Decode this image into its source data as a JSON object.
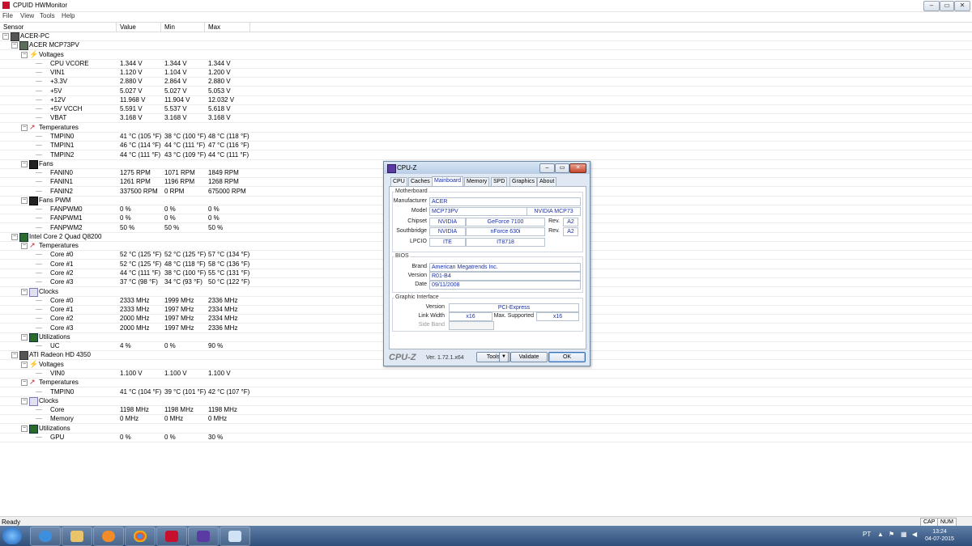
{
  "window": {
    "title": "CPUID HWMonitor",
    "menu": [
      "File",
      "View",
      "Tools",
      "Help"
    ]
  },
  "columns": {
    "sensor": "Sensor",
    "value": "Value",
    "min": "Min",
    "max": "Max"
  },
  "tree": [
    {
      "level": 0,
      "label": "ACER-PC",
      "icon": "computer-icon",
      "exp": true
    },
    {
      "level": 1,
      "label": "ACER MCP73PV",
      "icon": "motherboard-icon",
      "exp": true
    },
    {
      "level": 2,
      "label": "Voltages",
      "icon": "voltage-icon",
      "exp": true
    },
    {
      "level": 3,
      "label": "CPU VCORE",
      "value": "1.344 V",
      "min": "1.344 V",
      "max": "1.344 V"
    },
    {
      "level": 3,
      "label": "VIN1",
      "value": "1.120 V",
      "min": "1.104 V",
      "max": "1.200 V"
    },
    {
      "level": 3,
      "label": "+3.3V",
      "value": "2.880 V",
      "min": "2.864 V",
      "max": "2.880 V"
    },
    {
      "level": 3,
      "label": "+5V",
      "value": "5.027 V",
      "min": "5.027 V",
      "max": "5.053 V"
    },
    {
      "level": 3,
      "label": "+12V",
      "value": "11.968 V",
      "min": "11.904 V",
      "max": "12.032 V"
    },
    {
      "level": 3,
      "label": "+5V VCCH",
      "value": "5.591 V",
      "min": "5.537 V",
      "max": "5.618 V"
    },
    {
      "level": 3,
      "label": "VBAT",
      "value": "3.168 V",
      "min": "3.168 V",
      "max": "3.168 V"
    },
    {
      "level": 2,
      "label": "Temperatures",
      "icon": "thermometer-icon",
      "exp": true
    },
    {
      "level": 3,
      "label": "TMPIN0",
      "value": "41 °C  (105 °F)",
      "min": "38 °C  (100 °F)",
      "max": "48 °C  (118 °F)"
    },
    {
      "level": 3,
      "label": "TMPIN1",
      "value": "46 °C  (114 °F)",
      "min": "44 °C  (111 °F)",
      "max": "47 °C  (116 °F)"
    },
    {
      "level": 3,
      "label": "TMPIN2",
      "value": "44 °C  (111 °F)",
      "min": "43 °C  (109 °F)",
      "max": "44 °C  (111 °F)"
    },
    {
      "level": 2,
      "label": "Fans",
      "icon": "fan-icon",
      "exp": true
    },
    {
      "level": 3,
      "label": "FANIN0",
      "value": "1275 RPM",
      "min": "1071 RPM",
      "max": "1849 RPM"
    },
    {
      "level": 3,
      "label": "FANIN1",
      "value": "1261 RPM",
      "min": "1196 RPM",
      "max": "1268 RPM"
    },
    {
      "level": 3,
      "label": "FANIN2",
      "value": "337500 RPM",
      "min": "0 RPM",
      "max": "675000 RPM"
    },
    {
      "level": 2,
      "label": "Fans PWM",
      "icon": "fan-icon",
      "exp": true
    },
    {
      "level": 3,
      "label": "FANPWM0",
      "value": "0 %",
      "min": "0 %",
      "max": "0 %"
    },
    {
      "level": 3,
      "label": "FANPWM1",
      "value": "0 %",
      "min": "0 %",
      "max": "0 %"
    },
    {
      "level": 3,
      "label": "FANPWM2",
      "value": "50 %",
      "min": "50 %",
      "max": "50 %"
    },
    {
      "level": 1,
      "label": "Intel Core 2 Quad Q8200",
      "icon": "cpu-icon",
      "exp": true
    },
    {
      "level": 2,
      "label": "Temperatures",
      "icon": "thermometer-icon",
      "exp": true
    },
    {
      "level": 3,
      "label": "Core #0",
      "value": "52 °C  (125 °F)",
      "min": "52 °C  (125 °F)",
      "max": "57 °C  (134 °F)"
    },
    {
      "level": 3,
      "label": "Core #1",
      "value": "52 °C  (125 °F)",
      "min": "48 °C  (118 °F)",
      "max": "58 °C  (136 °F)"
    },
    {
      "level": 3,
      "label": "Core #2",
      "value": "44 °C  (111 °F)",
      "min": "38 °C  (100 °F)",
      "max": "55 °C  (131 °F)"
    },
    {
      "level": 3,
      "label": "Core #3",
      "value": "37 °C  (98 °F)",
      "min": "34 °C  (93 °F)",
      "max": "50 °C  (122 °F)"
    },
    {
      "level": 2,
      "label": "Clocks",
      "icon": "clock-icon",
      "exp": true
    },
    {
      "level": 3,
      "label": "Core #0",
      "value": "2333 MHz",
      "min": "1999 MHz",
      "max": "2336 MHz"
    },
    {
      "level": 3,
      "label": "Core #1",
      "value": "2333 MHz",
      "min": "1997 MHz",
      "max": "2334 MHz"
    },
    {
      "level": 3,
      "label": "Core #2",
      "value": "2000 MHz",
      "min": "1997 MHz",
      "max": "2334 MHz"
    },
    {
      "level": 3,
      "label": "Core #3",
      "value": "2000 MHz",
      "min": "1997 MHz",
      "max": "2336 MHz"
    },
    {
      "level": 2,
      "label": "Utilizations",
      "icon": "utilization-icon",
      "exp": true
    },
    {
      "level": 3,
      "label": "UC",
      "value": "4 %",
      "min": "0 %",
      "max": "90 %"
    },
    {
      "level": 1,
      "label": "ATI Radeon HD 4350",
      "icon": "gpu-icon",
      "exp": true
    },
    {
      "level": 2,
      "label": "Voltages",
      "icon": "voltage-icon",
      "exp": true
    },
    {
      "level": 3,
      "label": "VIN0",
      "value": "1.100 V",
      "min": "1.100 V",
      "max": "1.100 V"
    },
    {
      "level": 2,
      "label": "Temperatures",
      "icon": "thermometer-icon",
      "exp": true
    },
    {
      "level": 3,
      "label": "TMPIN0",
      "value": "41 °C  (104 °F)",
      "min": "39 °C  (101 °F)",
      "max": "42 °C  (107 °F)"
    },
    {
      "level": 2,
      "label": "Clocks",
      "icon": "clock-icon",
      "exp": true
    },
    {
      "level": 3,
      "label": "Core",
      "value": "1198 MHz",
      "min": "1198 MHz",
      "max": "1198 MHz"
    },
    {
      "level": 3,
      "label": "Memory",
      "value": "0 MHz",
      "min": "0 MHz",
      "max": "0 MHz"
    },
    {
      "level": 2,
      "label": "Utilizations",
      "icon": "utilization-icon",
      "exp": true
    },
    {
      "level": 3,
      "label": "GPU",
      "value": "0 %",
      "min": "0 %",
      "max": "30 %"
    }
  ],
  "statusbar": {
    "text": "Ready",
    "cap": "CAP",
    "num": "NUM"
  },
  "cpuz": {
    "title": "CPU-Z",
    "tabs": [
      "CPU",
      "Caches",
      "Mainboard",
      "Memory",
      "SPD",
      "Graphics",
      "About"
    ],
    "active_tab": "Mainboard",
    "motherboard": {
      "group": "Motherboard",
      "manufacturer_label": "Manufacturer",
      "manufacturer": "ACER",
      "model_label": "Model",
      "model": "MCP73PV",
      "model2": "NVIDIA MCP73",
      "chipset_label": "Chipset",
      "chipset_vendor": "NVIDIA",
      "chipset": "GeForce 7100",
      "chipset_rev_label": "Rev.",
      "chipset_rev": "A2",
      "southbridge_label": "Southbridge",
      "southbridge_vendor": "NVIDIA",
      "southbridge": "nForce 630i",
      "southbridge_rev_label": "Rev.",
      "southbridge_rev": "A2",
      "lpcio_label": "LPCIO",
      "lpcio_vendor": "ITE",
      "lpcio": "IT8718"
    },
    "bios": {
      "group": "BIOS",
      "brand_label": "Brand",
      "brand": "American Megatrends Inc.",
      "version_label": "Version",
      "version": "R01-B4",
      "date_label": "Date",
      "date": "09/11/2008"
    },
    "graphic": {
      "group": "Graphic Interface",
      "version_label": "Version",
      "version": "PCI-Express",
      "link_width_label": "Link Width",
      "link_width": "x16",
      "max_supported_label": "Max. Supported",
      "max_supported": "x16",
      "side_band_label": "Side Band"
    },
    "footer": {
      "logo": "CPU-Z",
      "version": "Ver. 1.72.1.x64",
      "tools": "Tools",
      "validate": "Validate",
      "ok": "OK"
    }
  },
  "taskbar": {
    "lang": "PT",
    "time": "13:24",
    "date": "04-07-2015"
  }
}
